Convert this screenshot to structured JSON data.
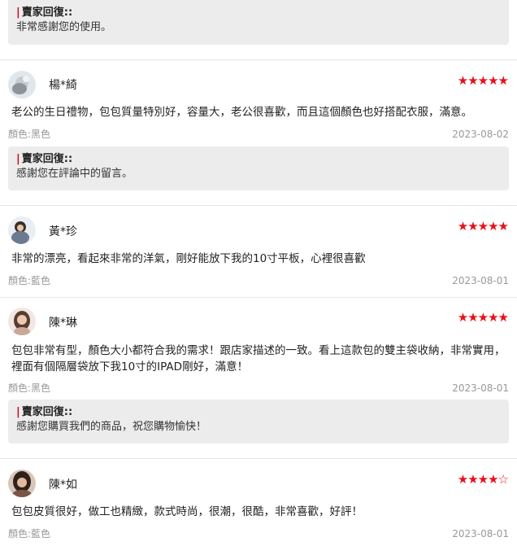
{
  "reply_heading": "賣家回復::",
  "top_reply": {
    "text": "非常感謝您的使用。"
  },
  "reviews": [
    {
      "username": "楊*綺",
      "rating": 5,
      "stars_text": "★★★★★",
      "content": "老公的生日禮物，包包質量特別好，容量大，老公很喜歡，而且這個顏色也好搭配衣服，滿意。",
      "color_label": "顏色:黑色",
      "date": "2023-08-02",
      "reply": "感謝您在評論中的留言。"
    },
    {
      "username": "黃*珍",
      "rating": 5,
      "stars_text": "★★★★★",
      "content": "非常的漂亮，看起來非常的洋氣，剛好能放下我的10寸平板，心裡很喜歡",
      "color_label": "顏色:藍色",
      "date": "2023-08-01"
    },
    {
      "username": "陳*琳",
      "rating": 5,
      "stars_text": "★★★★★",
      "content": "包包非常有型，顏色大小都符合我的需求！跟店家描述的一致。看上這款包的雙主袋收納，非常實用，裡面有個隔層袋放下我10寸的IPAD剛好，滿意！",
      "color_label": "顏色:黑色",
      "date": "2023-08-01",
      "reply": "感謝您購買我們的商品，祝您購物愉快！"
    },
    {
      "username": "陳*如",
      "rating": 4,
      "stars_text": "★★★★",
      "stars_empty": "☆",
      "content": "包包皮質很好，做工也精緻，款式時尚，很潮，很酷，非常喜歡，好評！",
      "color_label": "顏色:藍色",
      "date": "2023-08-01"
    }
  ],
  "colors": {
    "star": "#e8101a",
    "reply_bg": "#ececec",
    "reply_bar": "#d0021b"
  }
}
